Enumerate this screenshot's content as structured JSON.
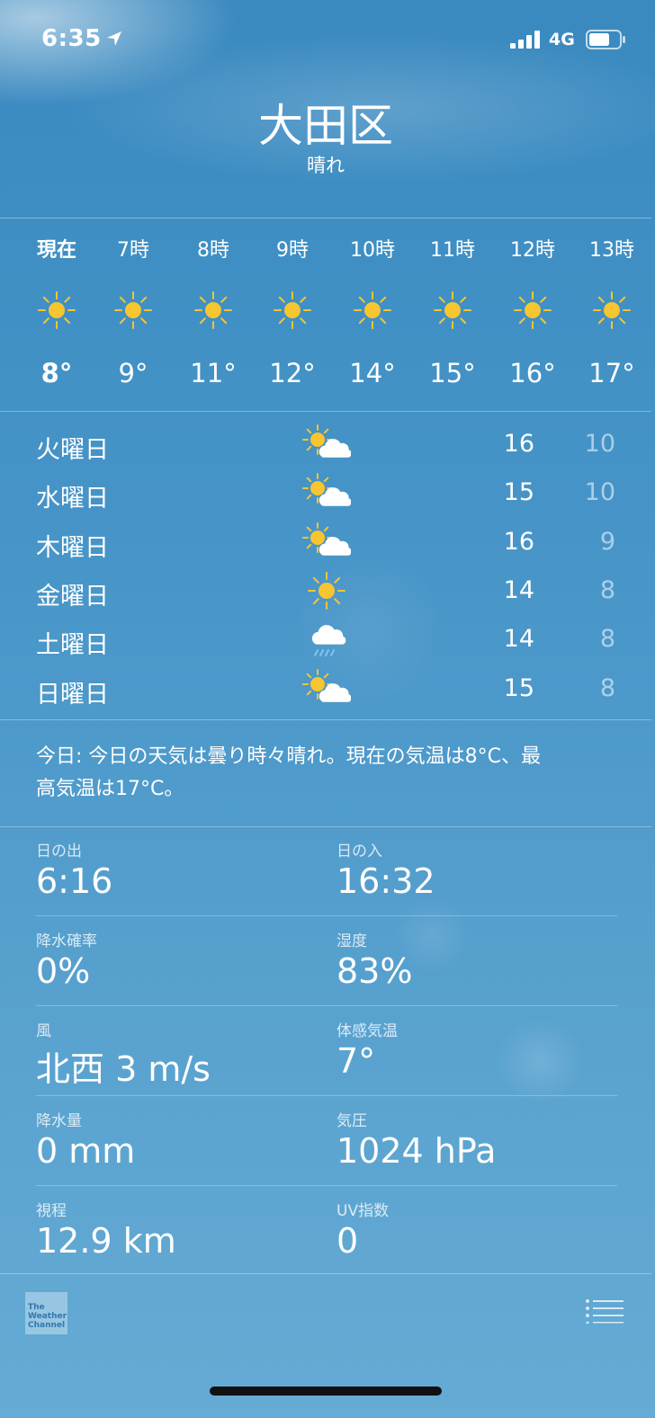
{
  "status_bar": {
    "time": "6:35",
    "network": "4G"
  },
  "location": {
    "city": "大田区",
    "condition": "晴れ"
  },
  "hourly": [
    {
      "label": "現在",
      "icon": "sun-icon",
      "temp": "8°"
    },
    {
      "label": "7時",
      "icon": "sun-icon",
      "temp": "9°"
    },
    {
      "label": "8時",
      "icon": "sun-icon",
      "temp": "11°"
    },
    {
      "label": "9時",
      "icon": "sun-icon",
      "temp": "12°"
    },
    {
      "label": "10時",
      "icon": "sun-icon",
      "temp": "14°"
    },
    {
      "label": "11時",
      "icon": "sun-icon",
      "temp": "15°"
    },
    {
      "label": "12時",
      "icon": "sun-icon",
      "temp": "16°"
    },
    {
      "label": "13時",
      "icon": "sun-icon",
      "temp": "17°"
    }
  ],
  "daily": [
    {
      "day": "火曜日",
      "icon": "partly-cloudy-icon",
      "high": "16",
      "low": "10"
    },
    {
      "day": "水曜日",
      "icon": "partly-cloudy-icon",
      "high": "15",
      "low": "10"
    },
    {
      "day": "木曜日",
      "icon": "partly-cloudy-icon",
      "high": "16",
      "low": "9"
    },
    {
      "day": "金曜日",
      "icon": "sun-icon",
      "high": "14",
      "low": "8"
    },
    {
      "day": "土曜日",
      "icon": "rain-cloud-icon",
      "high": "14",
      "low": "8"
    },
    {
      "day": "日曜日",
      "icon": "partly-cloudy-icon",
      "high": "15",
      "low": "8"
    }
  ],
  "summary": {
    "line1": "今日: 今日の天気は曇り時々晴れ。現在の気温は8°C、最",
    "line2": "高気温は17°C。"
  },
  "details": [
    {
      "left_label": "日の出",
      "left_value": "6:16",
      "right_label": "日の入",
      "right_value": "16:32"
    },
    {
      "left_label": "降水確率",
      "left_value": "0%",
      "right_label": "湿度",
      "right_value": "83%"
    },
    {
      "left_label": "風",
      "left_value": "北西 3 m/s",
      "right_label": "体感気温",
      "right_value": "7°"
    },
    {
      "left_label": "降水量",
      "left_value": "0 mm",
      "right_label": "気圧",
      "right_value": "1024 hPa"
    },
    {
      "left_label": "視程",
      "left_value": "12.9 km",
      "right_label": "UV指数",
      "right_value": "0"
    }
  ],
  "footer": {
    "logo_text": "The Weather Channel",
    "menu_icon": "list-icon"
  },
  "colors": {
    "sun": "#f7c530",
    "background": "#3f8fc4",
    "rain": "#7fc4f2"
  }
}
